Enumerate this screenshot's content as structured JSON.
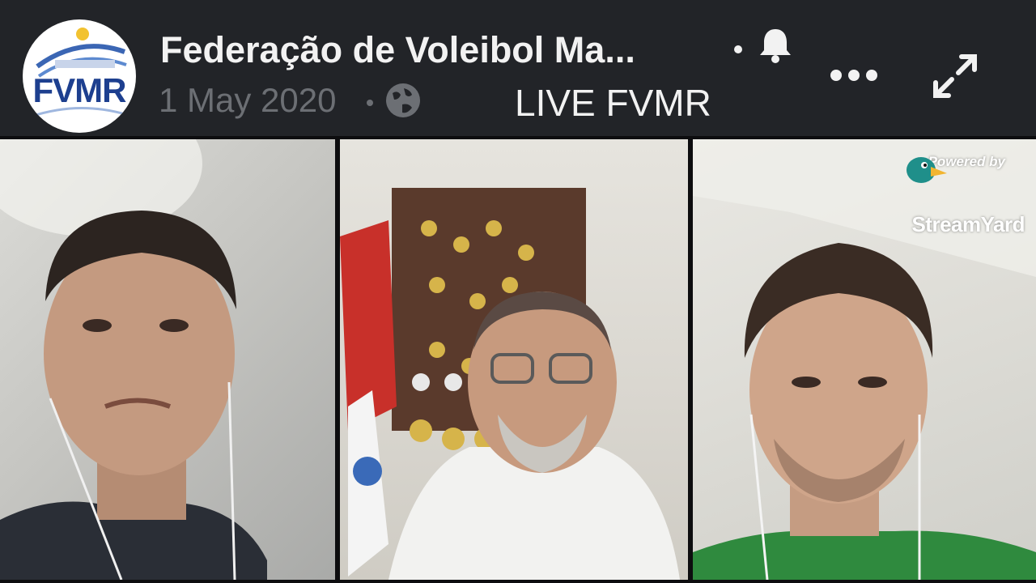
{
  "header": {
    "page_logo_text": "FVMR",
    "page_title": "Federação de Voleibol Ma...",
    "post_date": "1 May 2020",
    "video_caption": "LIVE FVMR",
    "icons": {
      "notification": "bell-icon",
      "more_options": "more-icon",
      "audience": "globe-icon",
      "expand": "fullscreen-icon"
    }
  },
  "video": {
    "participants": 3,
    "overlay": {
      "powered_by": "Powered by",
      "brand": "StreamYard",
      "brand_icon": "streamyard-duck-icon"
    }
  },
  "colors": {
    "header_bg": "#222428",
    "title_text": "#f2f2f2",
    "date_text": "#6c6f74",
    "logo_blue": "#1d3f8f"
  }
}
